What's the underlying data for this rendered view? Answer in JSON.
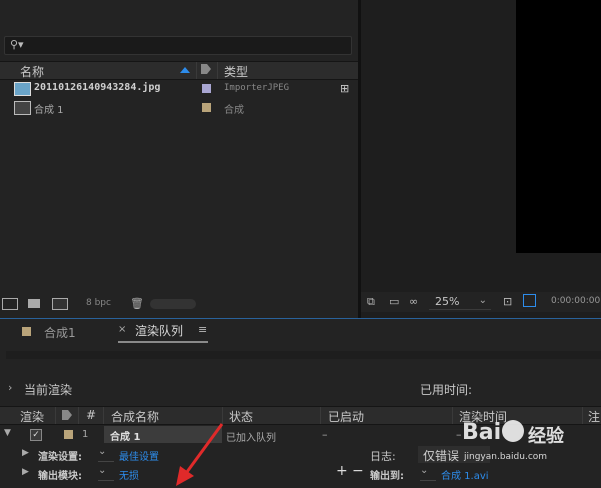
{
  "project": {
    "search_placeholder": "",
    "columns": {
      "name": "名称",
      "type": "类型"
    },
    "items": [
      {
        "name": "20110126140943284.jpg",
        "type": "ImporterJPEG",
        "swatch": "#a9a6d2"
      },
      {
        "name": "合成 1",
        "type": "合成",
        "swatch": "#b9a47a"
      }
    ],
    "bpc": "8 bpc"
  },
  "viewer": {
    "zoom": "25%",
    "timecode": "0:00:00:00"
  },
  "tabs": [
    {
      "label": "合成1",
      "swatch": "#b9a47a"
    },
    {
      "label": "渲染队列"
    }
  ],
  "render_queue": {
    "current_render_label": "当前渲染",
    "elapsed_label": "已用时间:",
    "columns": {
      "render": "渲染",
      "num": "#",
      "comp_name": "合成名称",
      "status": "状态",
      "started": "已启动",
      "render_time": "渲染时间",
      "note": "注"
    },
    "item": {
      "num": "1",
      "comp_name": "合成 1",
      "status": "已加入队列",
      "started": "–",
      "render_time": "–"
    },
    "render_settings_label": "渲染设置:",
    "render_settings_value": "最佳设置",
    "log_label": "日志:",
    "log_value": "仅错误",
    "output_module_label": "输出模块:",
    "output_module_value": "无损",
    "output_to_label": "输出到:",
    "output_to_value": "合成 1.avi"
  },
  "watermark": {
    "brand": "Bai",
    "brand2": "经验",
    "url": "jingyan.baidu.com"
  },
  "colors": {
    "accent_blue": "#2d8ceb",
    "annotation_red": "#e02a2a"
  }
}
